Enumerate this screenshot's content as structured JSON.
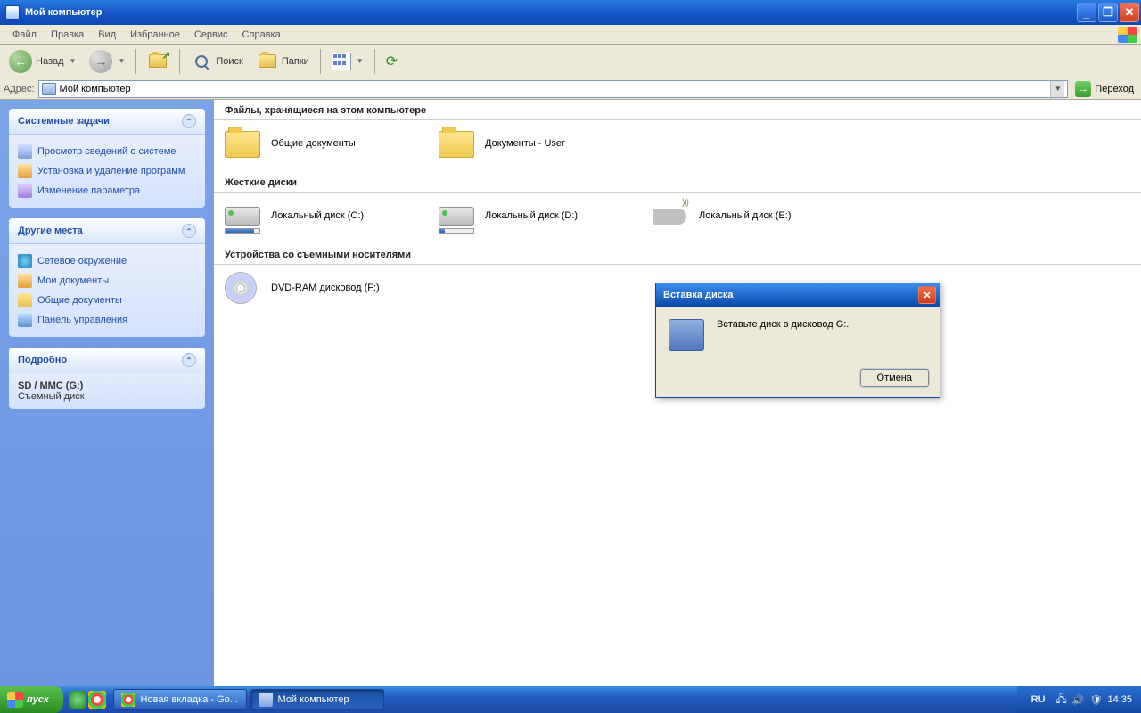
{
  "window": {
    "title": "Мой компьютер"
  },
  "menu": {
    "items": [
      "Файл",
      "Правка",
      "Вид",
      "Избранное",
      "Сервис",
      "Справка"
    ]
  },
  "toolbar": {
    "back": "Назад",
    "search": "Поиск",
    "folders": "Папки"
  },
  "addressbar": {
    "label": "Адрес:",
    "value": "Мой компьютер",
    "go": "Переход"
  },
  "sidebar": {
    "panels": [
      {
        "title": "Системные задачи",
        "links": [
          "Просмотр сведений о системе",
          "Установка и удаление программ",
          "Изменение параметра"
        ]
      },
      {
        "title": "Другие места",
        "links": [
          "Сетевое окружение",
          "Мои документы",
          "Общие документы",
          "Панель управления"
        ]
      },
      {
        "title": "Подробно",
        "detail_name": "SD / MMC (G:)",
        "detail_type": "Съемный диск"
      }
    ]
  },
  "content": {
    "sections": [
      {
        "header": "Файлы, хранящиеся на этом компьютере",
        "items": [
          {
            "label": "Общие документы",
            "kind": "folder"
          },
          {
            "label": "Документы - User",
            "kind": "folder"
          }
        ]
      },
      {
        "header": "Жесткие диски",
        "items": [
          {
            "label": "Локальный диск (C:)",
            "kind": "hdd",
            "usage": 85
          },
          {
            "label": "Локальный диск (D:)",
            "kind": "hdd",
            "usage": 15
          },
          {
            "label": "Локальный диск (E:)",
            "kind": "usb"
          }
        ]
      },
      {
        "header": "Устройства со съемными носителями",
        "items": [
          {
            "label": "DVD-RAM дисковод (F:)",
            "kind": "cd"
          }
        ]
      }
    ]
  },
  "dialog": {
    "title": "Вставка диска",
    "message": "Вставьте диск в дисковод G:.",
    "cancel": "Отмена"
  },
  "taskbar": {
    "start": "пуск",
    "tasks": [
      {
        "label": "Новая вкладка - Go..."
      },
      {
        "label": "Мой компьютер"
      }
    ],
    "lang": "RU",
    "time": "14:35"
  }
}
